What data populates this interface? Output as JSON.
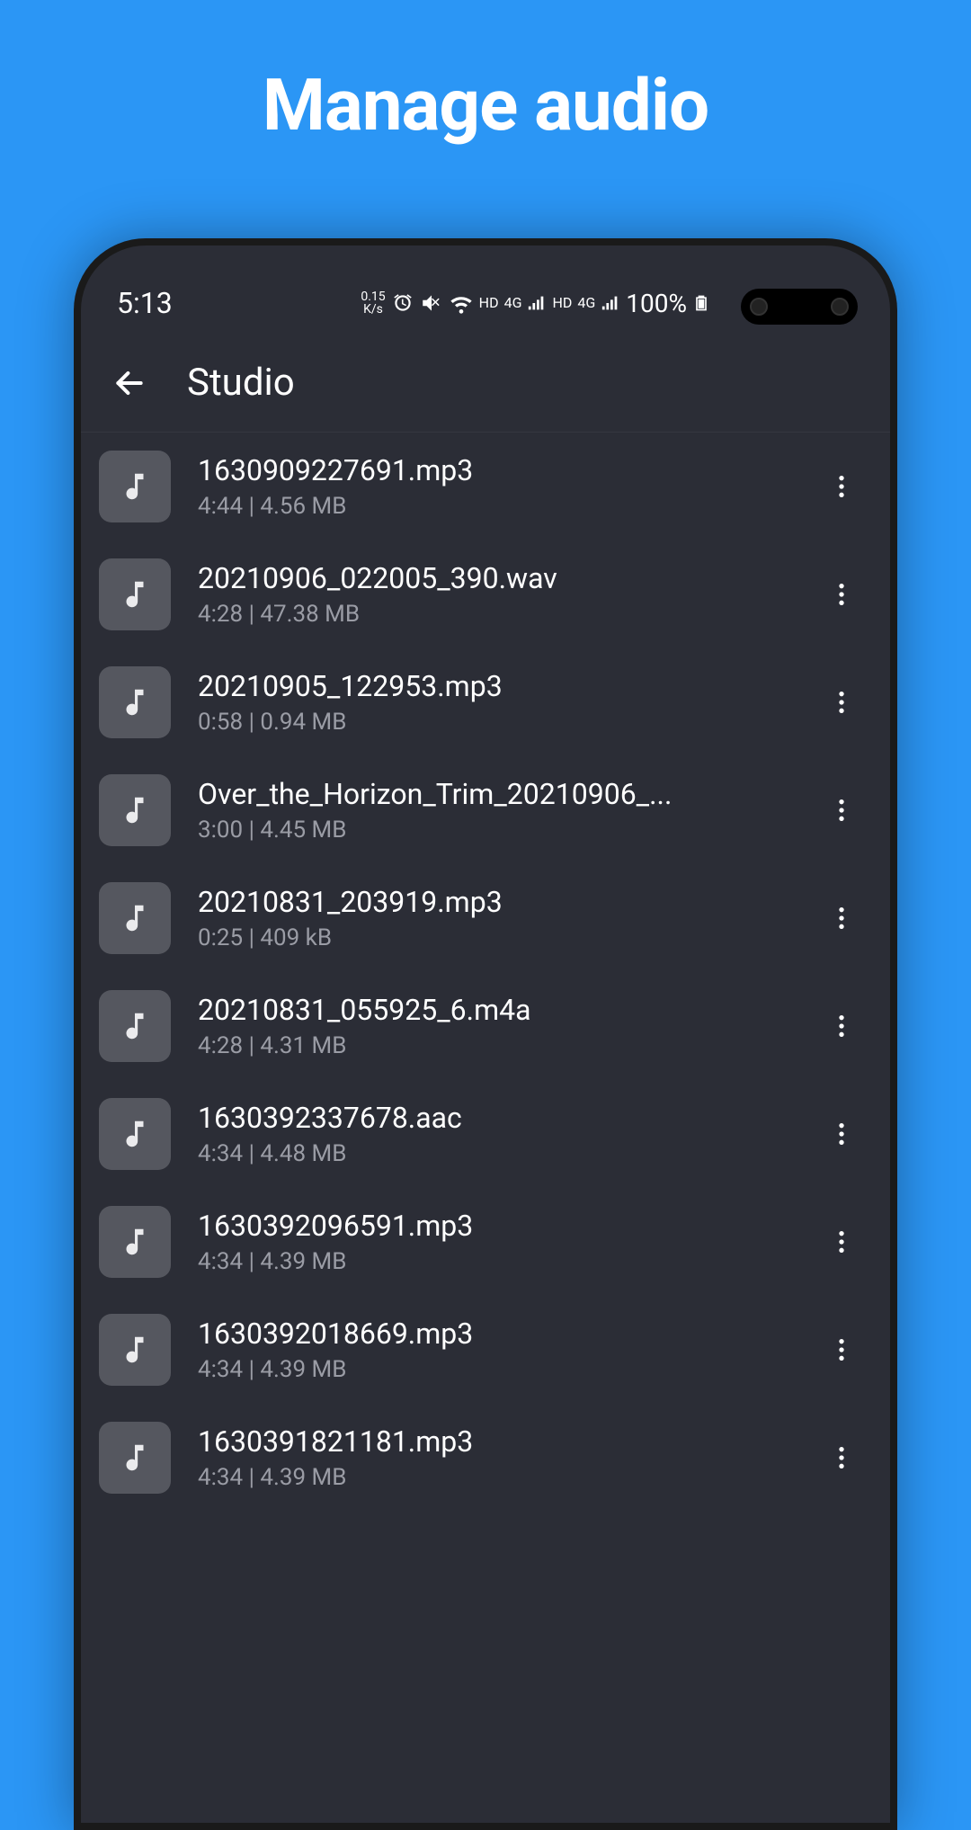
{
  "promo": {
    "title": "Manage audio"
  },
  "statusBar": {
    "time": "5:13",
    "speed_top": "0.15",
    "speed_unit": "K/s",
    "batteryPct": "100%"
  },
  "appBar": {
    "title": "Studio"
  },
  "audios": [
    {
      "filename": "1630909227691.mp3",
      "meta": "4:44 | 4.56 MB"
    },
    {
      "filename": "20210906_022005_390.wav",
      "meta": "4:28 | 47.38 MB"
    },
    {
      "filename": "20210905_122953.mp3",
      "meta": "0:58 | 0.94 MB"
    },
    {
      "filename": "Over_the_Horizon_Trim_20210906_...",
      "meta": "3:00 | 4.45 MB"
    },
    {
      "filename": "20210831_203919.mp3",
      "meta": "0:25 | 409 kB"
    },
    {
      "filename": "20210831_055925_6.m4a",
      "meta": "4:28 | 4.31 MB"
    },
    {
      "filename": "1630392337678.aac",
      "meta": "4:34 | 4.48 MB"
    },
    {
      "filename": "1630392096591.mp3",
      "meta": "4:34 | 4.39 MB"
    },
    {
      "filename": "1630392018669.mp3",
      "meta": "4:34 | 4.39 MB"
    },
    {
      "filename": "1630391821181.mp3",
      "meta": "4:34 | 4.39 MB"
    }
  ]
}
